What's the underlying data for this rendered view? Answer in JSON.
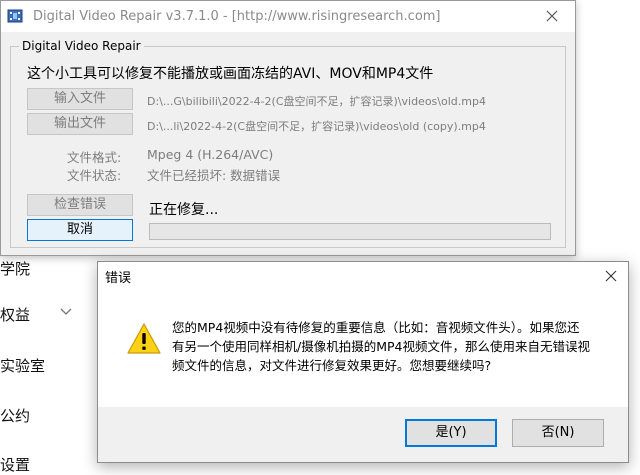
{
  "background_nav": {
    "items": [
      "学院",
      "权益",
      "实验室",
      "公约",
      "设置"
    ]
  },
  "app_window": {
    "title": "Digital Video Repair v3.7.1.0 - [http://www.risingresearch.com]",
    "group_label": "Digital Video Repair",
    "description": "这个小工具可以修复不能播放或画面冻结的AVI、MOV和MP4文件",
    "input_button": "输入文件",
    "input_path": "D:\\...G\\bilibili\\2022-4-2(C盘空间不足，扩容记录)\\videos\\old.mp4",
    "output_button": "输出文件",
    "output_path": "D:\\...li\\2022-4-2(C盘空间不足，扩容记录)\\videos\\old (copy).mp4",
    "format_label": "文件格式:",
    "format_value": "Mpeg 4 (H.264/AVC)",
    "state_label": "文件状态:",
    "state_value": "文件已经损坏: 数据错误",
    "check_button": "检查错误",
    "cancel_button": "取消",
    "status_text": "正在修复...",
    "progress": 0
  },
  "error_dialog": {
    "title": "错误",
    "message": "您的MP4视频中没有待修复的重要信息（比如：音视频文件头）。如果您还有另一个使用同样相机/摄像机拍摄的MP4视频文件，那么使用来自无错误视频文件的信息，对文件进行修复效果更好。您想要继续吗?",
    "yes_button": "是(Y)",
    "no_button": "否(N)"
  }
}
